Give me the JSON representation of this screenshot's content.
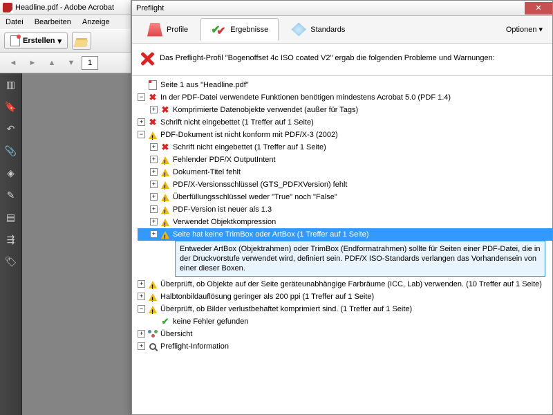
{
  "main": {
    "title": "Headline.pdf - Adobe Acrobat",
    "menu": {
      "file": "Datei",
      "edit": "Bearbeiten",
      "view": "Anzeige"
    },
    "toolbar": {
      "create": "Erstellen"
    },
    "page_number": "1"
  },
  "preflight": {
    "title": "Preflight",
    "tabs": {
      "profile": "Profile",
      "results": "Ergebnisse",
      "standards": "Standards"
    },
    "options": "Optionen",
    "summary": "Das Preflight-Profil \"Bogenoffset 4c ISO coated V2\" ergab die folgenden Probleme und Warnungen:",
    "tree": {
      "r0": "Seite 1 aus \"Headline.pdf\"",
      "r1": "In der PDF-Datei verwendete Funktionen benötigen mindestens Acrobat 5.0 (PDF 1.4)",
      "r2": "Komprimierte Datenobjekte verwendet (außer für Tags)",
      "r3": "Schrift nicht eingebettet (1 Treffer auf 1 Seite)",
      "r4": "PDF-Dokument ist nicht konform mit PDF/X-3 (2002)",
      "r5": "Schrift nicht eingebettet (1 Treffer auf 1 Seite)",
      "r6": "Fehlender PDF/X OutputIntent",
      "r7": "Dokument-Titel fehlt",
      "r8": "PDF/X-Versionsschlüssel (GTS_PDFXVersion) fehlt",
      "r9": "Überfüllungsschlüssel weder \"True\" noch \"False\"",
      "r10": "PDF-Version ist neuer als 1.3",
      "r11": "Verwendet Objektkompression",
      "r12": "Seite hat keine TrimBox oder ArtBox (1 Treffer auf 1 Seite)",
      "r12_detail": "Entweder ArtBox (Objektrahmen) oder TrimBox (Endformatrahmen) sollte für Seiten einer PDF-Datei, die in der Druckvorstufe verwendet wird, definiert sein. PDF/X ISO-Standards verlangen das Vorhandensein von einer dieser Boxen.",
      "r13": "Überprüft, ob Objekte auf der Seite geräteunabhängige Farbräume (ICC, Lab) verwenden. (10 Treffer auf 1 Seite)",
      "r14": "Halbtonbildauflösung geringer als 200 ppi (1 Treffer auf 1 Seite)",
      "r15": "Überprüft, ob Bilder verlustbehaftet komprimiert sind. (1 Treffer auf 1 Seite)",
      "r16": "keine Fehler gefunden",
      "r17": "Übersicht",
      "r18": "Preflight-Information"
    }
  }
}
